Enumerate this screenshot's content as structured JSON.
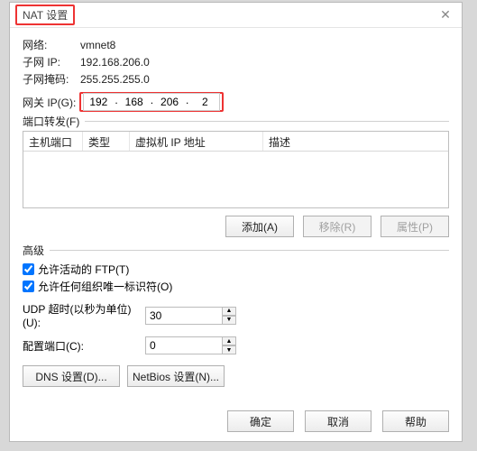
{
  "title": "NAT 设置",
  "close_glyph": "✕",
  "info": {
    "network_label": "网络:",
    "network_value": "vmnet8",
    "subnet_ip_label": "子网 IP:",
    "subnet_ip_value": "192.168.206.0",
    "subnet_mask_label": "子网掩码:",
    "subnet_mask_value": "255.255.255.0",
    "gateway_label": "网关 IP(G):",
    "gateway_oct1": "192",
    "gateway_oct2": "168",
    "gateway_oct3": "206",
    "gateway_oct4": "2"
  },
  "port_forward": {
    "legend": "端口转发(F)",
    "col_host_port": "主机端口",
    "col_type": "类型",
    "col_vm_ip": "虚拟机 IP 地址",
    "col_desc": "描述",
    "btn_add": "添加(A)",
    "btn_remove": "移除(R)",
    "btn_props": "属性(P)"
  },
  "advanced": {
    "legend": "高级",
    "chk_ftp_label": "允许活动的 FTP(T)",
    "chk_oui_label": "允许任何组织唯一标识符(O)",
    "udp_label": "UDP 超时(以秒为单位)(U):",
    "udp_value": "30",
    "cfg_port_label": "配置端口(C):",
    "cfg_port_value": "0",
    "btn_dns": "DNS 设置(D)...",
    "btn_netbios": "NetBios 设置(N)..."
  },
  "footer": {
    "ok": "确定",
    "cancel": "取消",
    "help": "帮助"
  },
  "spin_up": "▲",
  "spin_down": "▼",
  "dot": "."
}
